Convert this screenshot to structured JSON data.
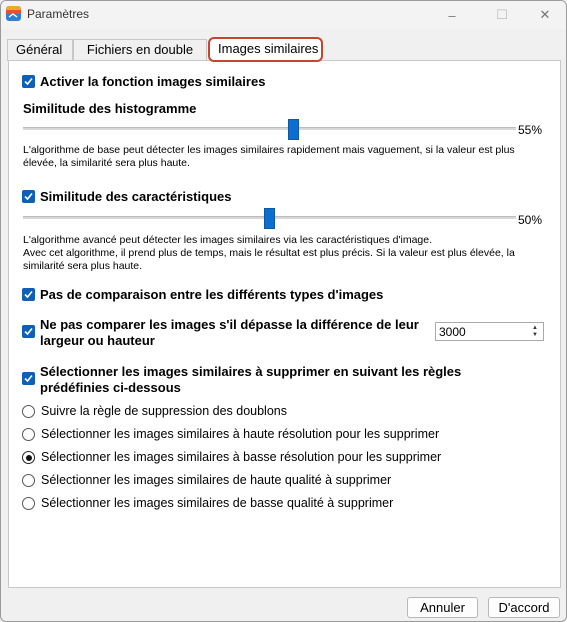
{
  "window": {
    "title": "Paramètres",
    "minimize": "–",
    "maximize": "☐",
    "close": "✕"
  },
  "tabs": [
    "Général",
    "Fichiers en double",
    "Images similaires"
  ],
  "active_tab": "Images similaires",
  "settings": {
    "enable_label": "Activer la fonction images similaires",
    "histogram_label": "Similitude des histogramme",
    "histogram_value": 55,
    "histogram_value_text": "55%",
    "histogram_desc": [
      "L'algorithme de base peut détecter les images similaires rapidement mais vaguement, si la valeur est plus",
      "élevée, la similarité sera plus haute."
    ],
    "features_label": "Similitude des caractéristiques",
    "features_value": 50,
    "features_value_text": "50%",
    "features_desc": [
      "L'algorithme avancé peut détecter les images similaires via les caractéristiques d'image.",
      "Avec cet algorithme, il prend plus de temps, mais le résultat est plus précis. Si la valeur est plus élevée, la",
      "similarité sera plus haute."
    ],
    "no_compare_types_label": "Pas de comparaison entre les différents types d'images",
    "size_diff_label": [
      "Ne pas comparer les images s'il dépasse la différence de leur",
      "largeur ou hauteur"
    ],
    "size_diff_value": "3000",
    "select_rules_label": [
      "Sélectionner les images similaires à supprimer en suivant les règles",
      "prédéfinies ci-dessous"
    ],
    "rules": [
      {
        "label": "Suivre la règle de suppression des doublons",
        "selected": false
      },
      {
        "label": "Sélectionner les images similaires à haute résolution pour les supprimer",
        "selected": false
      },
      {
        "label": "Sélectionner les images similaires à basse résolution pour les supprimer",
        "selected": true
      },
      {
        "label": "Sélectionner les images similaires de haute qualité à supprimer",
        "selected": false
      },
      {
        "label": "Sélectionner les images similaires de basse qualité à supprimer",
        "selected": false
      }
    ]
  },
  "footer": {
    "cancel": "Annuler",
    "ok": "D'accord"
  },
  "colors": {
    "accent": "#0d5fb8",
    "active_tab_border": "#c8442a"
  }
}
